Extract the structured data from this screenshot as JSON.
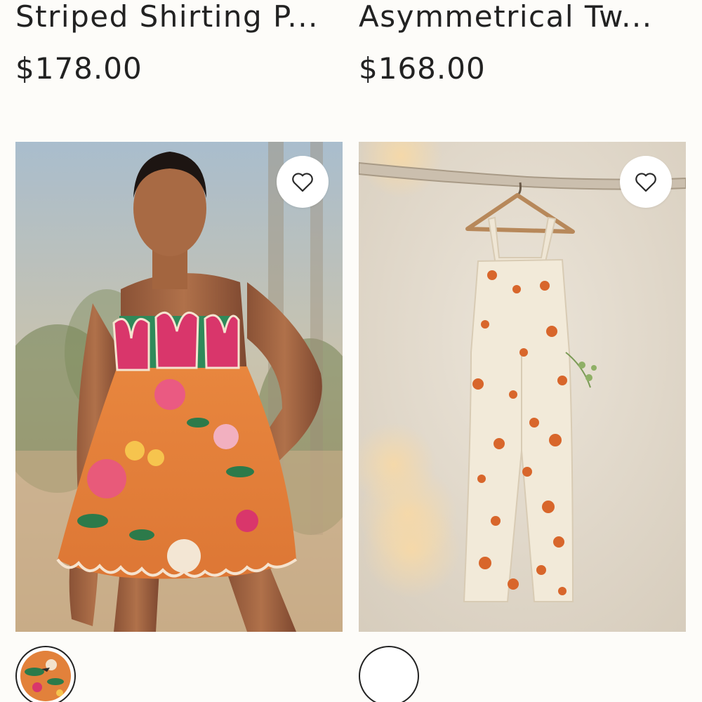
{
  "products": [
    {
      "title": "Striped Shirting P...",
      "price": "$178.00",
      "favorite_icon": "heart-outline-icon",
      "image": "model-in-strapless-orange-floral-romper-with-tulip-bodice",
      "swatch": "orange-floral-print-swatch"
    },
    {
      "title": "Asymmetrical Tw...",
      "price": "$168.00",
      "favorite_icon": "heart-outline-icon",
      "image": "cream-overalls-with-orange-flower-print-on-hanger",
      "swatch": "empty-swatch"
    }
  ],
  "colors": {
    "background": "#fdfcf9",
    "text": "#222222",
    "fav_button_bg": "#ffffff"
  }
}
